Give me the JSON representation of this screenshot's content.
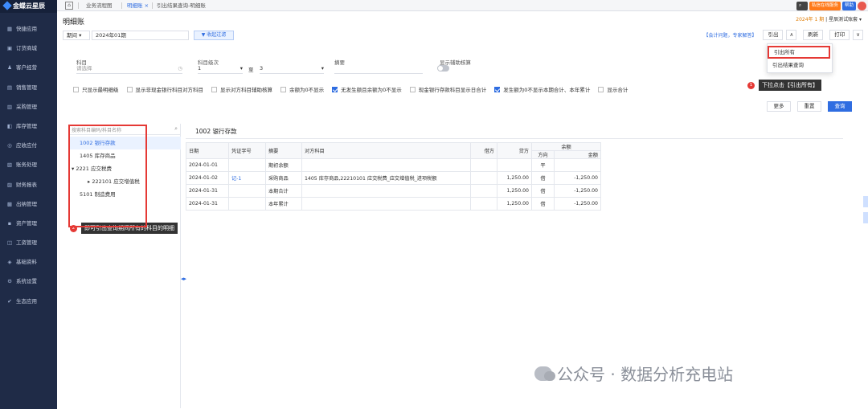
{
  "app": {
    "logo": "金蝶云星辰"
  },
  "sidebar": {
    "items": [
      {
        "icon": "grid-icon",
        "glyph": "▦",
        "label": "快捷应用"
      },
      {
        "icon": "shop-icon",
        "glyph": "▣",
        "label": "订货商城"
      },
      {
        "icon": "customer-icon",
        "glyph": "♟",
        "label": "客户经营"
      },
      {
        "icon": "sales-icon",
        "glyph": "▤",
        "label": "销售管理"
      },
      {
        "icon": "purchase-icon",
        "glyph": "▥",
        "label": "采购管理"
      },
      {
        "icon": "inventory-icon",
        "glyph": "◧",
        "label": "库存管理"
      },
      {
        "icon": "receivable-icon",
        "glyph": "◎",
        "label": "应收应付"
      },
      {
        "icon": "account-icon",
        "glyph": "▧",
        "label": "账务处理"
      },
      {
        "icon": "report-icon",
        "glyph": "▨",
        "label": "财务报表"
      },
      {
        "icon": "cashier-icon",
        "glyph": "▩",
        "label": "出纳管理"
      },
      {
        "icon": "asset-icon",
        "glyph": "▪",
        "label": "资产管理"
      },
      {
        "icon": "payroll-icon",
        "glyph": "◫",
        "label": "工资管理"
      },
      {
        "icon": "basedata-icon",
        "glyph": "◈",
        "label": "基础资料"
      },
      {
        "icon": "settings-icon",
        "glyph": "⚙",
        "label": "系统设置"
      },
      {
        "icon": "eco-icon",
        "glyph": "✔",
        "label": "生态应用"
      }
    ]
  },
  "tabs": {
    "flow": "业务流程图",
    "ledger": "明细账",
    "export": "引出结果查询-明细账"
  },
  "topright": {
    "online": "私信在线服务",
    "help": "帮助"
  },
  "header": {
    "title": "明细账",
    "period_label": "期间",
    "period_value": "2024年01期",
    "collapse_filter": "收起过滤",
    "account_info": "2024年 1 期",
    "account_book": "星辰测试账套",
    "links": "【会计问题，专家解答】",
    "export": "引出",
    "refresh": "刷新",
    "print": "打印"
  },
  "export_menu": {
    "items": [
      "引出所有",
      "引出结果查询"
    ]
  },
  "filters": {
    "subject_label": "科目",
    "subject_placeholder": "请选择",
    "level_label": "科目级次",
    "level_from": "1",
    "level_to_label": "至",
    "level_to": "3",
    "summary_label": "摘要",
    "aux_label": "显示辅助核算"
  },
  "checkboxes": [
    {
      "label": "只显示最明细级",
      "checked": false
    },
    {
      "label": "显示非现金银行科目对方科目",
      "checked": false
    },
    {
      "label": "显示对方科目辅助核算",
      "checked": false
    },
    {
      "label": "余额为0不显示",
      "checked": false
    },
    {
      "label": "无发生额且余额为0不显示",
      "checked": true
    },
    {
      "label": "现金银行存款科目显示日合计",
      "checked": false
    },
    {
      "label": "发生额为0不显示本期合计、本年累计",
      "checked": true
    },
    {
      "label": "显示合计",
      "checked": false
    }
  ],
  "actions": {
    "more": "更多",
    "reset": "重置",
    "query": "查询"
  },
  "callouts": {
    "c1_num": "1",
    "c1_text": "下拉点击【引出所有】",
    "c2_num": "2",
    "c2_text": "即可引出查询期间所有的科目的明细"
  },
  "tree": {
    "search_placeholder": "搜索科目编码/科目名称",
    "nodes": [
      {
        "label": "1002 银行存款",
        "level": 1,
        "caret": "",
        "selected": true
      },
      {
        "label": "1405 库存商品",
        "level": 1,
        "caret": "",
        "selected": false
      },
      {
        "label": "2221 应交税费",
        "level": 0,
        "caret": "▾",
        "selected": false
      },
      {
        "label": "222101 应交增值税",
        "level": 2,
        "caret": "▸",
        "selected": false
      },
      {
        "label": "5101 制造费用",
        "level": 1,
        "caret": "",
        "selected": false
      }
    ]
  },
  "ledger": {
    "title": "1002 银行存款",
    "headers": {
      "date": "日期",
      "voucher": "凭证字号",
      "summary": "摘要",
      "contra": "对方科目",
      "debit": "借方",
      "credit": "贷方",
      "balance": "余额",
      "direction": "方向",
      "amount": "金额"
    },
    "rows": [
      {
        "date": "2024-01-01",
        "voucher": "",
        "summary": "期初余额",
        "contra": "",
        "debit": "",
        "credit": "",
        "direction": "平",
        "amount": ""
      },
      {
        "date": "2024-01-02",
        "voucher": "记-1",
        "summary": "采购商品",
        "contra": "1405 库存商品,22210101 应交税费_应交增值税_进项税额",
        "debit": "",
        "credit": "1,250.00",
        "direction": "借",
        "amount": "-1,250.00"
      },
      {
        "date": "2024-01-31",
        "voucher": "",
        "summary": "本期合计",
        "contra": "",
        "debit": "",
        "credit": "1,250.00",
        "direction": "借",
        "amount": "-1,250.00"
      },
      {
        "date": "2024-01-31",
        "voucher": "",
        "summary": "本年累计",
        "contra": "",
        "debit": "",
        "credit": "1,250.00",
        "direction": "借",
        "amount": "-1,250.00"
      }
    ]
  },
  "watermark": "公众号 · 数据分析充电站",
  "colors": {
    "accent": "#2f6de1",
    "sidebar": "#1f2b47",
    "highlight": "#e53935"
  }
}
